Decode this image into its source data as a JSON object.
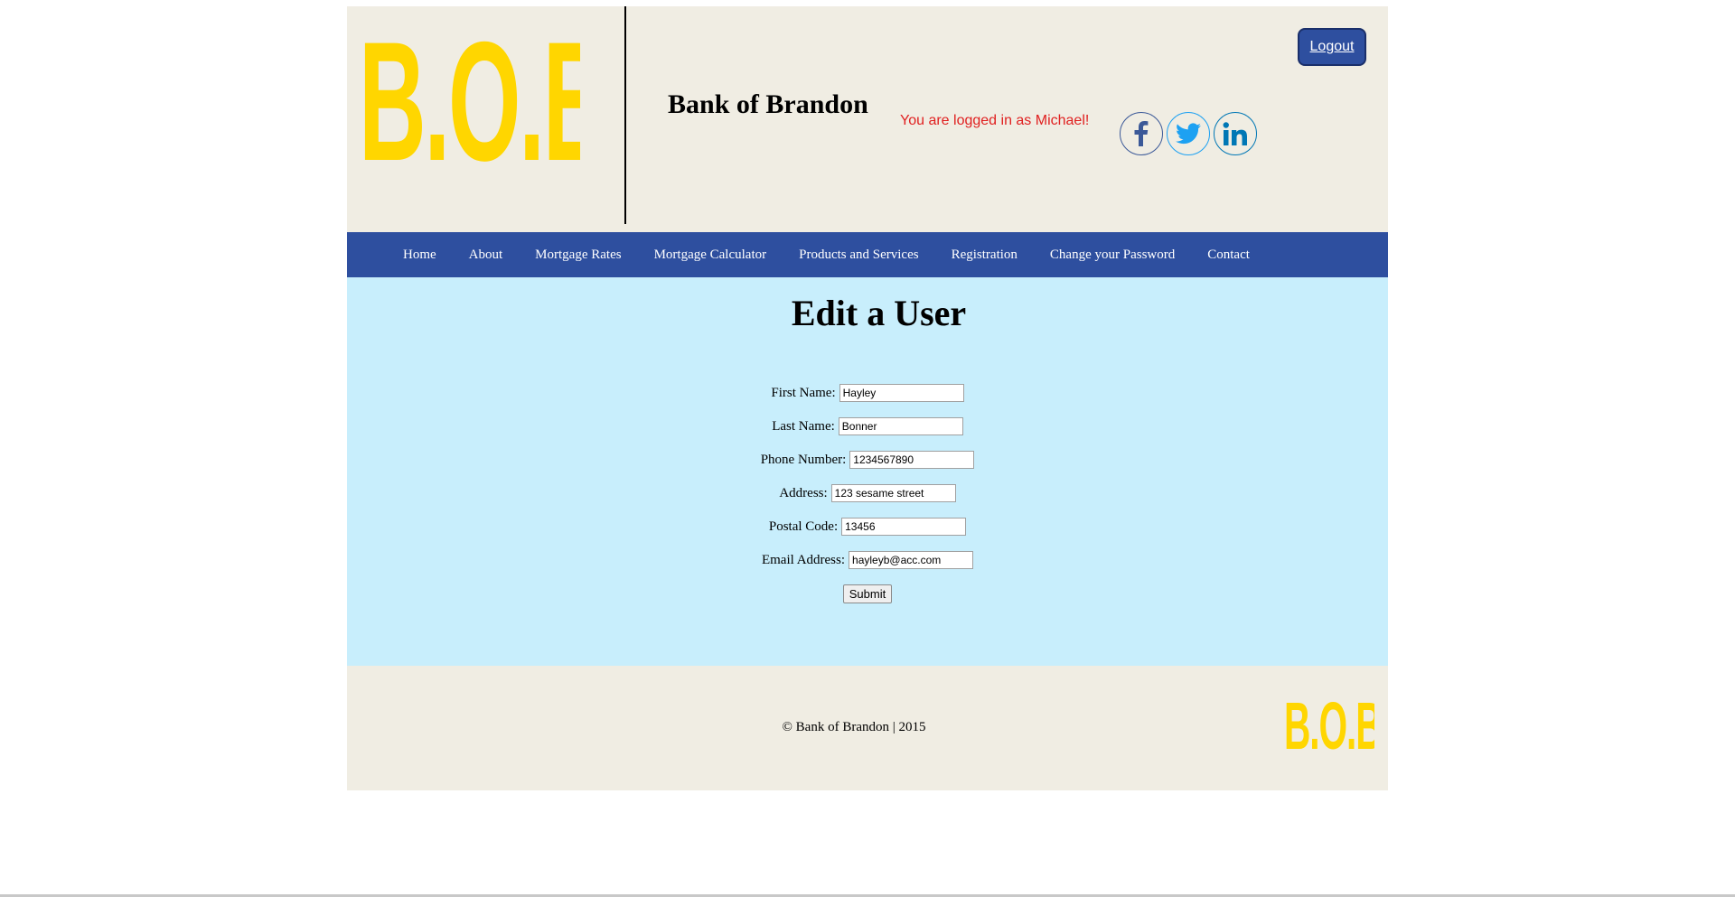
{
  "header": {
    "logo_text": "B.O.B",
    "bank_name": "Bank of Brandon",
    "logged_in_text": "You are logged in as Michael!",
    "logout_label": "Logout",
    "social": [
      "facebook-icon",
      "twitter-icon",
      "linkedin-icon"
    ]
  },
  "nav": {
    "items": [
      {
        "label": "Home"
      },
      {
        "label": "About"
      },
      {
        "label": "Mortgage Rates"
      },
      {
        "label": "Mortgage Calculator"
      },
      {
        "label": "Products and Services"
      },
      {
        "label": "Registration"
      },
      {
        "label": "Change your Password"
      },
      {
        "label": "Contact"
      }
    ]
  },
  "main": {
    "title": "Edit a User",
    "fields": [
      {
        "label": "First Name:",
        "value": "Hayley"
      },
      {
        "label": "Last Name:",
        "value": "Bonner"
      },
      {
        "label": "Phone Number:",
        "value": "1234567890"
      },
      {
        "label": "Address:",
        "value": "123 sesame street"
      },
      {
        "label": "Postal Code:",
        "value": "13456"
      },
      {
        "label": "Email Address:",
        "value": "hayleyb@acc.com"
      }
    ],
    "submit_label": "Submit"
  },
  "footer": {
    "copyright": "© Bank of Brandon | 2015",
    "logo_text": "B.O.B"
  },
  "colors": {
    "brand_blue": "#2e4f9f",
    "logo_yellow": "#ffd600",
    "header_bg": "#f0ede3",
    "content_bg": "#c8eefc",
    "alert_red": "#e02020"
  }
}
